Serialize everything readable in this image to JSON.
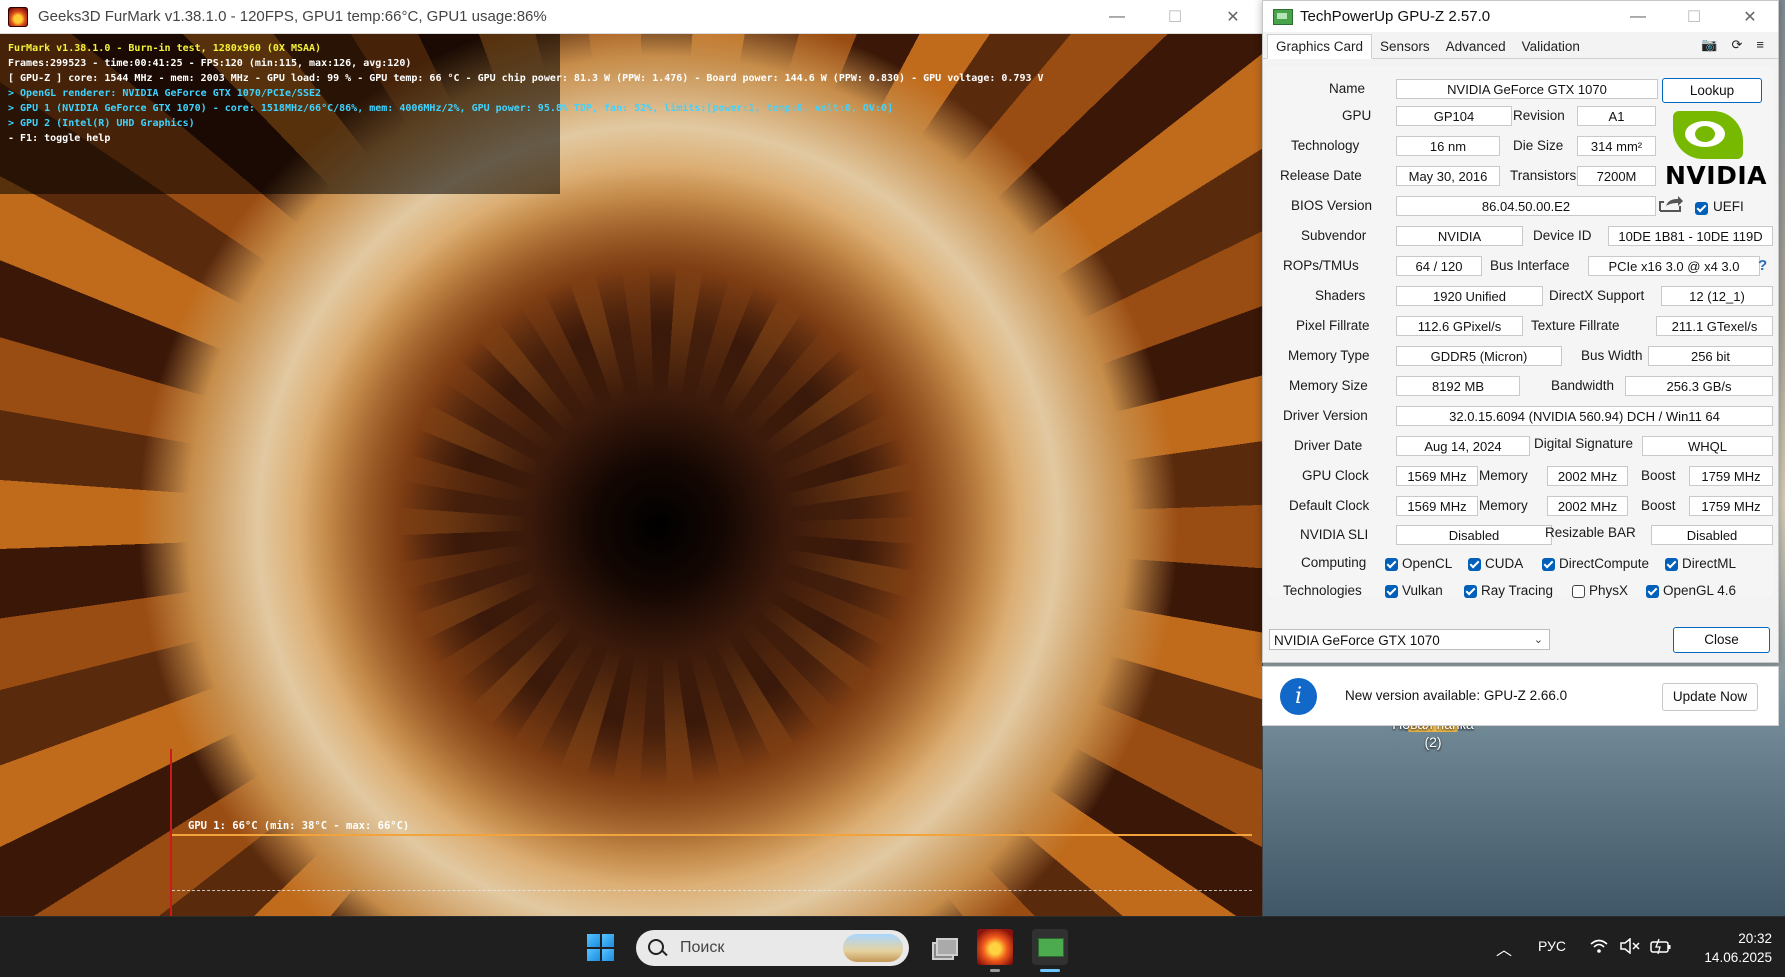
{
  "furmark": {
    "title": "Geeks3D FurMark v1.38.1.0 - 120FPS, GPU1 temp:66°C, GPU1 usage:86%",
    "hud": [
      {
        "text": "FurMark v1.38.1.0 - Burn-in test, 1280x960 (0X MSAA)",
        "color": "#f3f33a"
      },
      {
        "text": "Frames:299523 - time:00:41:25 - FPS:120 (min:115, max:126, avg:120)",
        "color": "#ffffff"
      },
      {
        "text": "[ GPU-Z ] core: 1544 MHz - mem: 2003 MHz - GPU load: 99 % - GPU temp: 66 °C - GPU chip power: 81.3 W (PPW: 1.476) - Board power: 144.6 W (PPW: 0.830) - GPU voltage: 0.793 V",
        "color": "#ffffff"
      },
      {
        "text": "> OpenGL renderer: NVIDIA GeForce GTX 1070/PCIe/SSE2",
        "color": "#3fd4ff"
      },
      {
        "text": "> GPU 1 (NVIDIA GeForce GTX 1070) - core: 1518MHz/66°C/86%, mem: 4006MHz/2%, GPU power: 95.8% TDP, fan: 52%, limits:[power:1, temp:0, volt:0, OV:0]",
        "color": "#3fd4ff"
      },
      {
        "text": "> GPU 2 (Intel(R) UHD Graphics)",
        "color": "#3fd4ff"
      },
      {
        "text": "- F1: toggle help",
        "color": "#ffffff"
      }
    ],
    "graph_label": "GPU 1: 66°C (min: 38°C - max: 66°C)"
  },
  "gpuz": {
    "title": "TechPowerUp GPU-Z 2.57.0",
    "tabs": [
      "Graphics Card",
      "Sensors",
      "Advanced",
      "Validation"
    ],
    "tool_icons": [
      "camera-icon",
      "refresh-icon",
      "menu-icon"
    ],
    "lookup": "Lookup",
    "uefi": "UEFI",
    "nvidia_text": "NVIDIA",
    "help": "?",
    "labels": {
      "name": "Name",
      "gpu": "GPU",
      "revision": "Revision",
      "technology": "Technology",
      "die_size": "Die Size",
      "release_date": "Release Date",
      "transistors": "Transistors",
      "bios": "BIOS Version",
      "subvendor": "Subvendor",
      "device_id": "Device ID",
      "rops": "ROPs/TMUs",
      "bus_interface": "Bus Interface",
      "shaders": "Shaders",
      "directx": "DirectX Support",
      "pixel_fillrate": "Pixel Fillrate",
      "texture_fillrate": "Texture Fillrate",
      "memory_type": "Memory Type",
      "bus_width": "Bus Width",
      "memory_size": "Memory Size",
      "bandwidth": "Bandwidth",
      "driver_version": "Driver Version",
      "driver_date": "Driver Date",
      "digital_signature": "Digital Signature",
      "gpu_clock": "GPU Clock",
      "memory": "Memory",
      "boost": "Boost",
      "default_clock": "Default Clock",
      "nvidia_sli": "NVIDIA SLI",
      "resizable_bar": "Resizable BAR",
      "computing": "Computing",
      "technologies": "Technologies"
    },
    "values": {
      "name": "NVIDIA GeForce GTX 1070",
      "gpu": "GP104",
      "revision": "A1",
      "technology": "16 nm",
      "die_size": "314 mm²",
      "release_date": "May 30, 2016",
      "transistors": "7200M",
      "bios": "86.04.50.00.E2",
      "subvendor": "NVIDIA",
      "device_id": "10DE 1B81 - 10DE 119D",
      "rops": "64 / 120",
      "bus_interface": "PCIe x16 3.0 @ x4 3.0",
      "shaders": "1920 Unified",
      "directx": "12 (12_1)",
      "pixel_fillrate": "112.6 GPixel/s",
      "texture_fillrate": "211.1 GTexel/s",
      "memory_type": "GDDR5 (Micron)",
      "bus_width": "256 bit",
      "memory_size": "8192 MB",
      "bandwidth": "256.3 GB/s",
      "driver_version": "32.0.15.6094 (NVIDIA 560.94) DCH / Win11 64",
      "driver_date": "Aug 14, 2024",
      "digital_signature": "WHQL",
      "gpu_clock": "1569 MHz",
      "gpu_memory": "2002 MHz",
      "gpu_boost": "1759 MHz",
      "default_clock": "1569 MHz",
      "default_memory": "2002 MHz",
      "default_boost": "1759 MHz",
      "nvidia_sli": "Disabled",
      "resizable_bar": "Disabled"
    },
    "computing": [
      {
        "label": "OpenCL",
        "checked": true
      },
      {
        "label": "CUDA",
        "checked": true
      },
      {
        "label": "DirectCompute",
        "checked": true
      },
      {
        "label": "DirectML",
        "checked": true
      }
    ],
    "technologies": [
      {
        "label": "Vulkan",
        "checked": true
      },
      {
        "label": "Ray Tracing",
        "checked": true
      },
      {
        "label": "PhysX",
        "checked": false
      },
      {
        "label": "OpenGL 4.6",
        "checked": true
      }
    ],
    "gpu_select": "NVIDIA GeForce GTX 1070",
    "close": "Close"
  },
  "update": {
    "text": "New version available: GPU-Z 2.66.0",
    "button": "Update Now"
  },
  "desktop": {
    "folder_label": "Новая папка",
    "folder_sub": "(2)"
  },
  "taskbar": {
    "search_placeholder": "Поиск",
    "lang": "РУС",
    "time": "20:32",
    "date": "14.06.2025",
    "underline_color": "#6cc6ff"
  }
}
